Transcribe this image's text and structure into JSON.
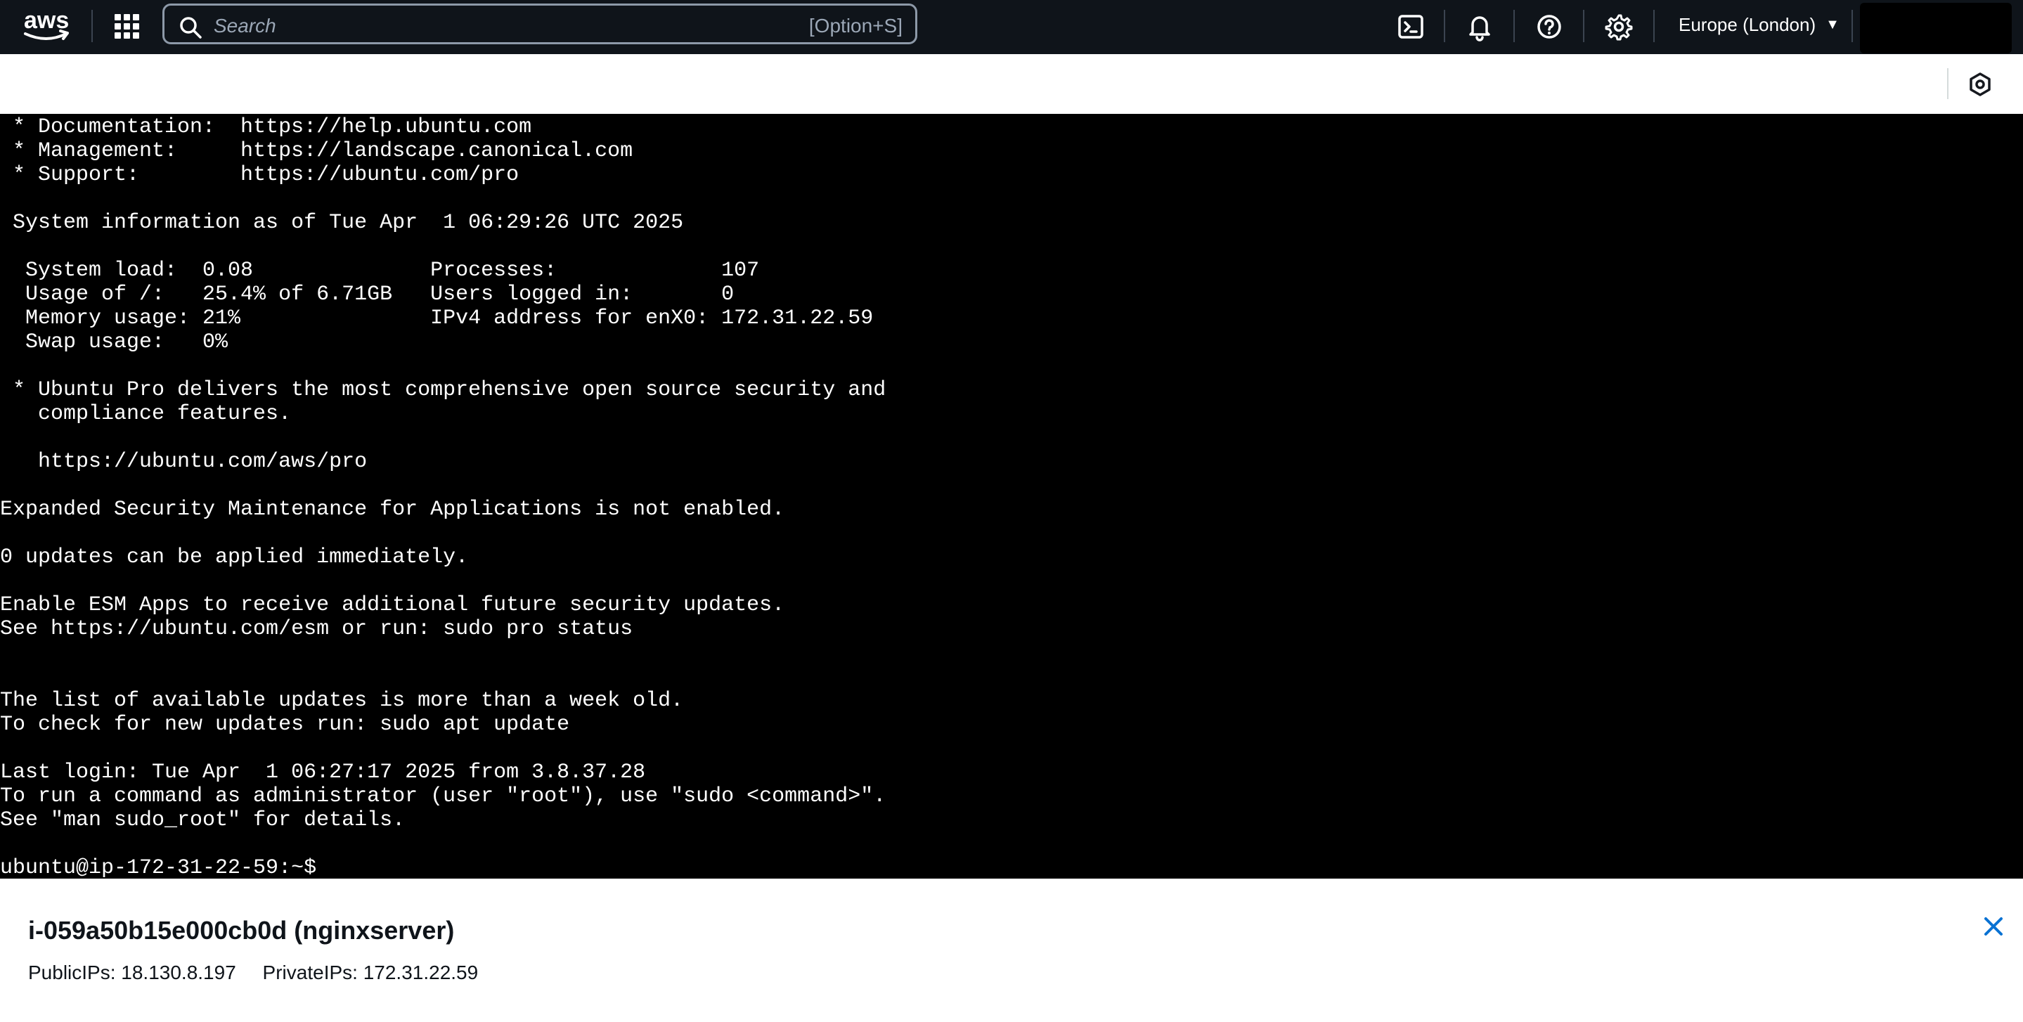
{
  "nav": {
    "logo_text": "aws",
    "search_placeholder": "Search",
    "search_shortcut": "[Option+S]",
    "region": "Europe (London)"
  },
  "terminal": {
    "lines": [
      " * Documentation:  https://help.ubuntu.com",
      " * Management:     https://landscape.canonical.com",
      " * Support:        https://ubuntu.com/pro",
      "",
      " System information as of Tue Apr  1 06:29:26 UTC 2025",
      "",
      "  System load:  0.08              Processes:             107",
      "  Usage of /:   25.4% of 6.71GB   Users logged in:       0",
      "  Memory usage: 21%               IPv4 address for enX0: 172.31.22.59",
      "  Swap usage:   0%",
      "",
      " * Ubuntu Pro delivers the most comprehensive open source security and",
      "   compliance features.",
      "",
      "   https://ubuntu.com/aws/pro",
      "",
      "Expanded Security Maintenance for Applications is not enabled.",
      "",
      "0 updates can be applied immediately.",
      "",
      "Enable ESM Apps to receive additional future security updates.",
      "See https://ubuntu.com/esm or run: sudo pro status",
      "",
      "",
      "The list of available updates is more than a week old.",
      "To check for new updates run: sudo apt update",
      "",
      "Last login: Tue Apr  1 06:27:17 2025 from 3.8.37.28",
      "To run a command as administrator (user \"root\"), use \"sudo <command>\".",
      "See \"man sudo_root\" for details.",
      "",
      "ubuntu@ip-172-31-22-59:~$ "
    ]
  },
  "instance": {
    "title": "i-059a50b15e000cb0d (nginxserver)",
    "public_ips": "PublicIPs: 18.130.8.197",
    "private_ips": "PrivateIPs: 172.31.22.59"
  },
  "colors": {
    "nav_bg": "#0f141a",
    "accent_orange": "#ff9900",
    "link_blue": "#0972d3"
  }
}
